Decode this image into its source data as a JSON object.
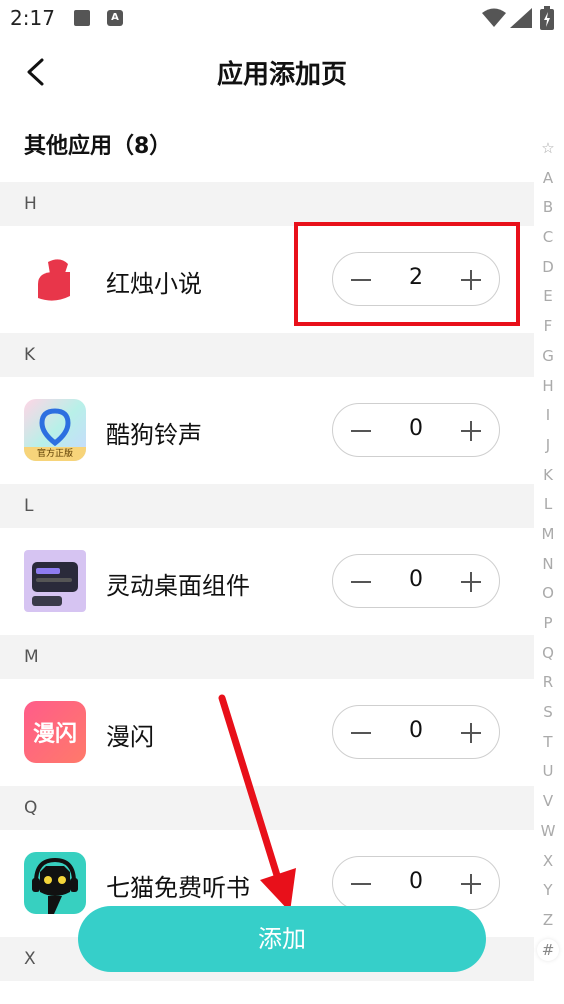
{
  "status_bar": {
    "time": "2:17",
    "notification_badge": "A"
  },
  "header": {
    "title": "应用添加页"
  },
  "section_title": "其他应用（8）",
  "groups": [
    {
      "letter": "H",
      "apps": [
        {
          "name": "红烛小说",
          "count": "2"
        }
      ]
    },
    {
      "letter": "K",
      "apps": [
        {
          "name": "酷狗铃声",
          "count": "0",
          "icon_caption": "官方正版"
        }
      ]
    },
    {
      "letter": "L",
      "apps": [
        {
          "name": "灵动桌面组件",
          "count": "0"
        }
      ]
    },
    {
      "letter": "M",
      "apps": [
        {
          "name": "漫闪",
          "count": "0",
          "icon_text": "漫闪"
        }
      ]
    },
    {
      "letter": "Q",
      "apps": [
        {
          "name": "七猫免费听书",
          "count": "0"
        }
      ]
    },
    {
      "letter": "X",
      "apps": []
    }
  ],
  "alphabet_index": [
    "☆",
    "A",
    "B",
    "C",
    "D",
    "E",
    "F",
    "G",
    "H",
    "I",
    "J",
    "K",
    "L",
    "M",
    "N",
    "O",
    "P",
    "Q",
    "R",
    "S",
    "T",
    "U",
    "V",
    "W",
    "X",
    "Y",
    "Z",
    "#"
  ],
  "add_button_label": "添加",
  "colors": {
    "accent": "#36cfc9",
    "highlight": "#e8101a"
  }
}
